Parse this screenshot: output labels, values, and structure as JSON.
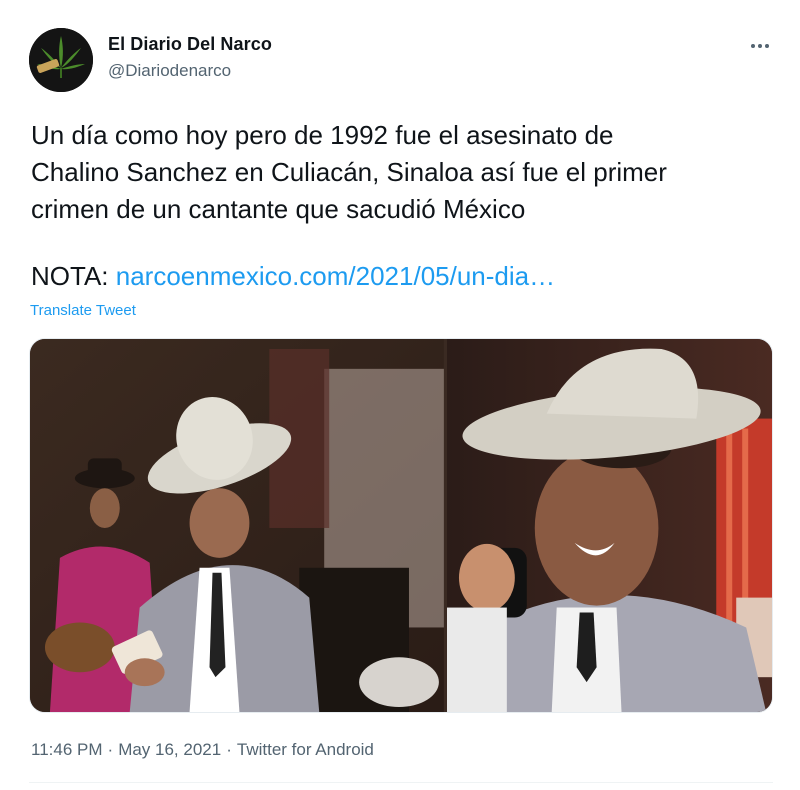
{
  "author": {
    "name": "El Diario Del Narco",
    "handle": "@Diariodenarco"
  },
  "tweet": {
    "lines": [
      "Un día como hoy pero de 1992 fue el asesinato de",
      "Chalino Sanchez en Culiacán, Sinaloa así fue el primer",
      "crimen de un cantante que sacudió México"
    ],
    "nota_label": "NOTA: ",
    "nota_link": "narcoenmexico.com/2021/05/un-dia…",
    "translate_label": "Translate Tweet"
  },
  "meta": {
    "time": "11:46 PM",
    "date": "May 16, 2021",
    "source": "Twitter for Android",
    "separator": "·"
  },
  "icons": {
    "avatar": "cannabis-leaf-logo",
    "more": "more-options-icon"
  },
  "colors": {
    "link": "#1d9bf0",
    "secondary_text": "#536471",
    "primary_text": "#0f1419"
  }
}
